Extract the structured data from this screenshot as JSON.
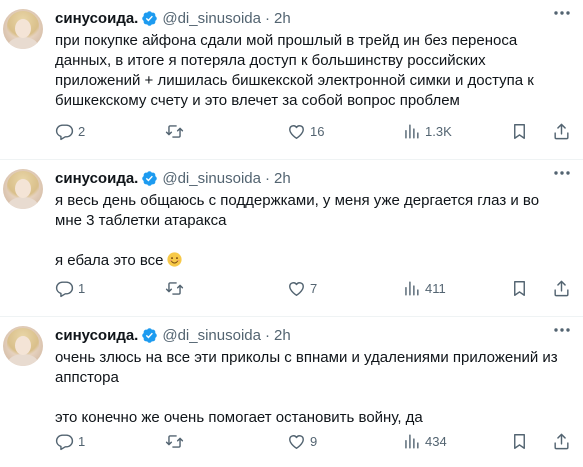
{
  "tweets": [
    {
      "name": "синусоида.",
      "handle": "@di_sinusoida",
      "dot": "·",
      "time": "2h",
      "text": "при покупке айфона сдали мой прошлый в трейд ин без переноса\nданных, в итоге я потеряла доступ к большинству российских\nприложений + лишилась бишкекской электронной симки и доступа к\nбишкекскому счету и это влечет за собой вопрос проблем",
      "emoji": "",
      "replies": "2",
      "retweets": "",
      "likes": "16",
      "views": "1.3K"
    },
    {
      "name": "синусоида.",
      "handle": "@di_sinusoida",
      "dot": "·",
      "time": "2h",
      "text": "я весь день общаюсь с поддержками, у меня уже дергается глаз и во\nмне 3 таблетки атаракса\n\nя ебала это все",
      "emoji": "smiling-face-emoji",
      "replies": "1",
      "retweets": "",
      "likes": "7",
      "views": "411"
    },
    {
      "name": "синусоида.",
      "handle": "@di_sinusoida",
      "dot": "·",
      "time": "2h",
      "text": "очень злюсь на все эти приколы с впнами и удалениями приложений из\nаппстора\n\nэто конечно же очень помогает остановить войну, да",
      "emoji": "",
      "replies": "1",
      "retweets": "",
      "likes": "9",
      "views": "434"
    }
  ],
  "colors": {
    "text": "#0f1419",
    "secondary": "#536471",
    "verified": "#1d9bf0",
    "divider": "#eff3f4"
  }
}
